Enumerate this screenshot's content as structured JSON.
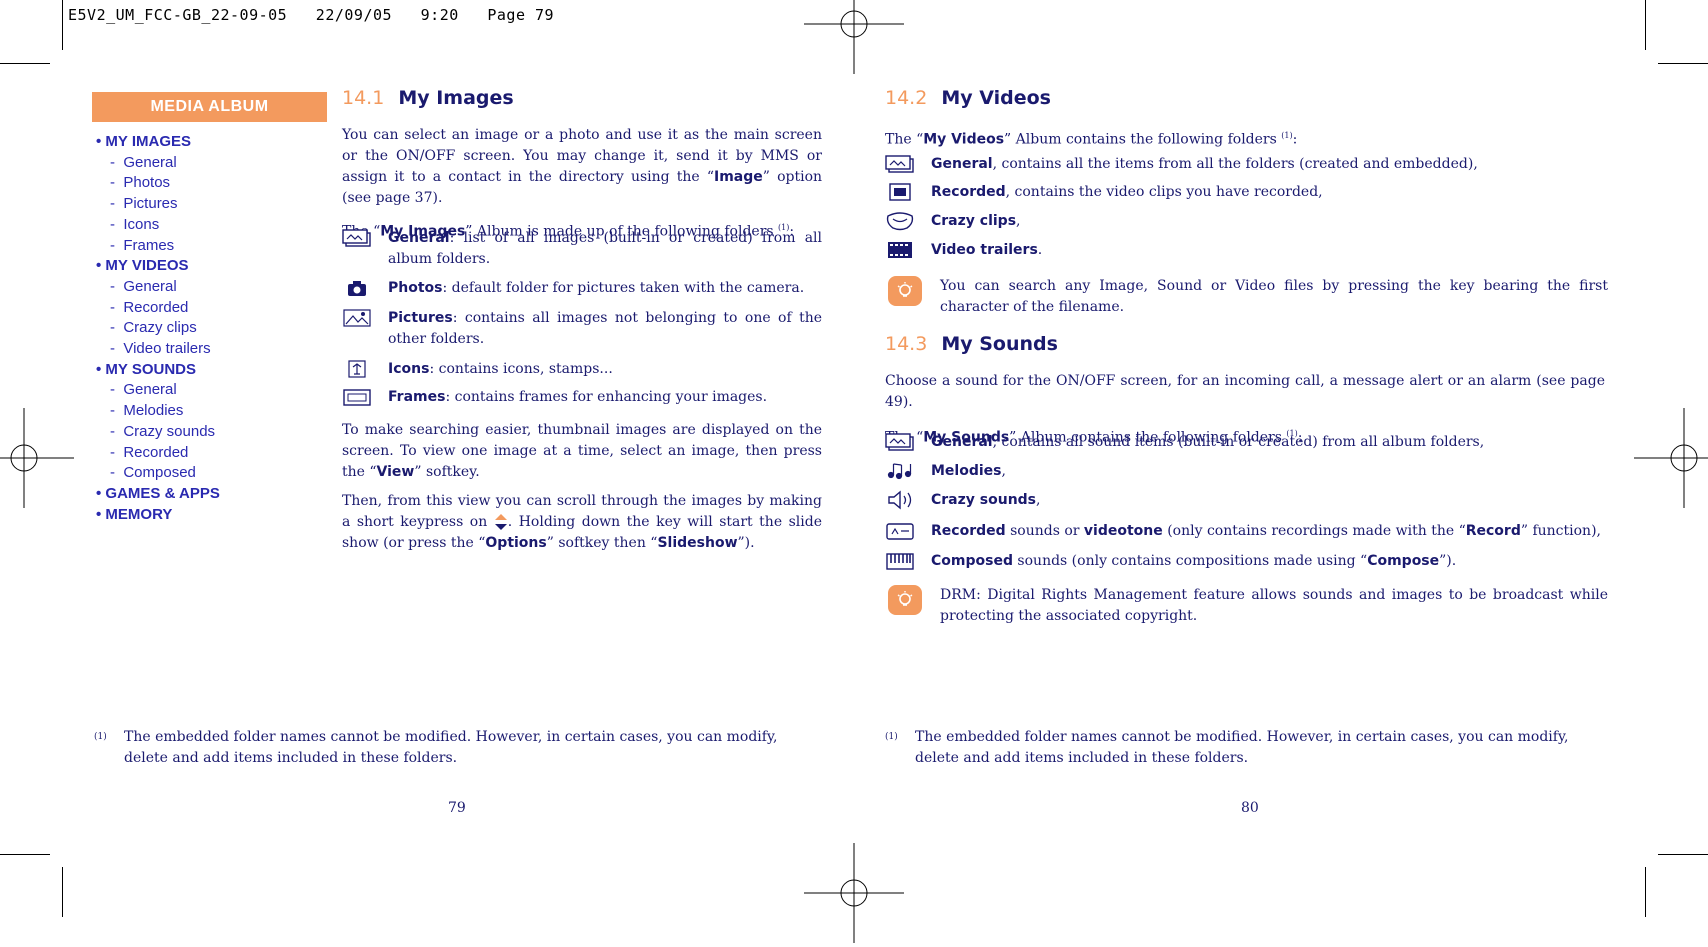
{
  "slug": "E5V2_UM_FCC-GB_22-09-05   22/09/05   9:20   Page 79",
  "sidebar": {
    "header": "MEDIA ALBUM",
    "items": [
      {
        "type": "cat",
        "label": "MY IMAGES"
      },
      {
        "type": "sub",
        "label": "General"
      },
      {
        "type": "sub",
        "label": "Photos"
      },
      {
        "type": "sub",
        "label": "Pictures"
      },
      {
        "type": "sub",
        "label": "Icons"
      },
      {
        "type": "sub",
        "label": "Frames"
      },
      {
        "type": "cat",
        "label": "MY VIDEOS"
      },
      {
        "type": "sub",
        "label": "General"
      },
      {
        "type": "sub",
        "label": "Recorded"
      },
      {
        "type": "sub",
        "label": "Crazy clips"
      },
      {
        "type": "sub",
        "label": "Video trailers"
      },
      {
        "type": "cat",
        "label": "MY SOUNDS"
      },
      {
        "type": "sub",
        "label": "General"
      },
      {
        "type": "sub",
        "label": "Melodies"
      },
      {
        "type": "sub",
        "label": "Crazy sounds"
      },
      {
        "type": "sub",
        "label": "Recorded"
      },
      {
        "type": "sub",
        "label": "Composed"
      },
      {
        "type": "cat",
        "label": "GAMES & APPS"
      },
      {
        "type": "cat",
        "label": "MEMORY"
      }
    ]
  },
  "left_page": {
    "section": {
      "number": "14.1",
      "title": "My Images"
    },
    "intro": {
      "p1a": "You can select an image or a photo and use it as the main screen or the ON/OFF screen. You may change it, send it by MMS or assign it to a contact in the directory using the “",
      "p1b": "Image",
      "p1c": "” option (see page 37).",
      "p2a": "The “",
      "p2b": "My Images",
      "p2c": "” Album is made up of the following folders ",
      "p2fn": "(1)",
      "p2d": ":"
    },
    "folders": [
      {
        "icon": "general-folder-icon",
        "name": "General",
        "desc": ": list of all images (built-in or created) from all album folders."
      },
      {
        "icon": "camera-icon",
        "name": "Photos",
        "desc": ": default folder for pictures taken with the camera."
      },
      {
        "icon": "pictures-icon",
        "name": "Pictures",
        "desc": ": contains all images not belonging to one of the other folders."
      },
      {
        "icon": "icons-folder-icon",
        "name": "Icons",
        "desc": ": contains icons, stamps..."
      },
      {
        "icon": "frame-icon",
        "name": "Frames",
        "desc": ": contains frames for enhancing your images."
      }
    ],
    "p3a": "To make searching easier, thumbnail images are displayed on the screen. To view one image at a time, select an image, then press the “",
    "p3b": "View",
    "p3c": "” softkey.",
    "p4a": "Then, from this view you can scroll through the images by making a short keypress on ",
    "p4b": ". Holding down the key will start the slide show (or press the “",
    "p4c": "Options",
    "p4d": "” softkey then “",
    "p4e": "Slideshow",
    "p4f": "”).",
    "footnote_mark": "(1)",
    "footnote": "The embedded folder names cannot be modified. However, in certain cases, you can modify, delete and add items included in these folders.",
    "page_number": "79"
  },
  "right_page": {
    "videos": {
      "section": {
        "number": "14.2",
        "title": "My Videos"
      },
      "intro_a": "The “",
      "intro_b": "My Videos",
      "intro_c": "” Album contains the following folders ",
      "intro_fn": "(1)",
      "intro_d": ":",
      "folders": [
        {
          "icon": "general-folder-icon",
          "name": "General",
          "desc": ", contains all the items from all the folders (created and embedded),"
        },
        {
          "icon": "video-recorded-icon",
          "name": "Recorded",
          "desc": ", contains the video clips you have recorded,"
        },
        {
          "icon": "crazy-clips-icon",
          "name": "Crazy clips",
          "desc": ","
        },
        {
          "icon": "video-trailers-icon",
          "name": "Video trailers",
          "desc": "."
        }
      ],
      "tip": "You can search any Image, Sound or Video files by pressing the key bearing the first character of the filename."
    },
    "sounds": {
      "section": {
        "number": "14.3",
        "title": "My Sounds"
      },
      "p1": "Choose a sound for the ON/OFF screen, for an incoming call, a message alert or an alarm (see page 49).",
      "intro_a": "The “",
      "intro_b": "My Sounds",
      "intro_c": "” Album contains the following folders ",
      "intro_fn": "(1)",
      "intro_d": ":",
      "folders": [
        {
          "icon": "general-folder-icon",
          "name": "General",
          "desc": ", contains all sound items (built-in or created) from all album folders,"
        },
        {
          "icon": "melodies-icon",
          "name": "Melodies",
          "desc": ","
        },
        {
          "icon": "crazy-sounds-icon",
          "name": "Crazy sounds",
          "desc": ","
        }
      ],
      "recorded": {
        "name": "Recorded",
        "mid": " sounds or ",
        "name2": "videotone",
        "tail_a": " (only contains recordings made with the “",
        "tail_b": "Record",
        "tail_c": "” function),"
      },
      "composed": {
        "name": "Composed",
        "tail_a": " sounds (only contains compositions made using “",
        "tail_b": "Compose",
        "tail_c": "”)."
      },
      "tip": "DRM: Digital Rights Management feature allows sounds and images to be broadcast while protecting the associated copyright."
    },
    "footnote_mark": "(1)",
    "footnote": "The embedded folder names cannot be modified. However, in certain cases, you can modify, delete and add items included in these folders.",
    "page_number": "80"
  },
  "colors": {
    "accent": "#f39a5e",
    "text": "#1a1a6e",
    "sidebar_text": "#2a2ab0"
  }
}
